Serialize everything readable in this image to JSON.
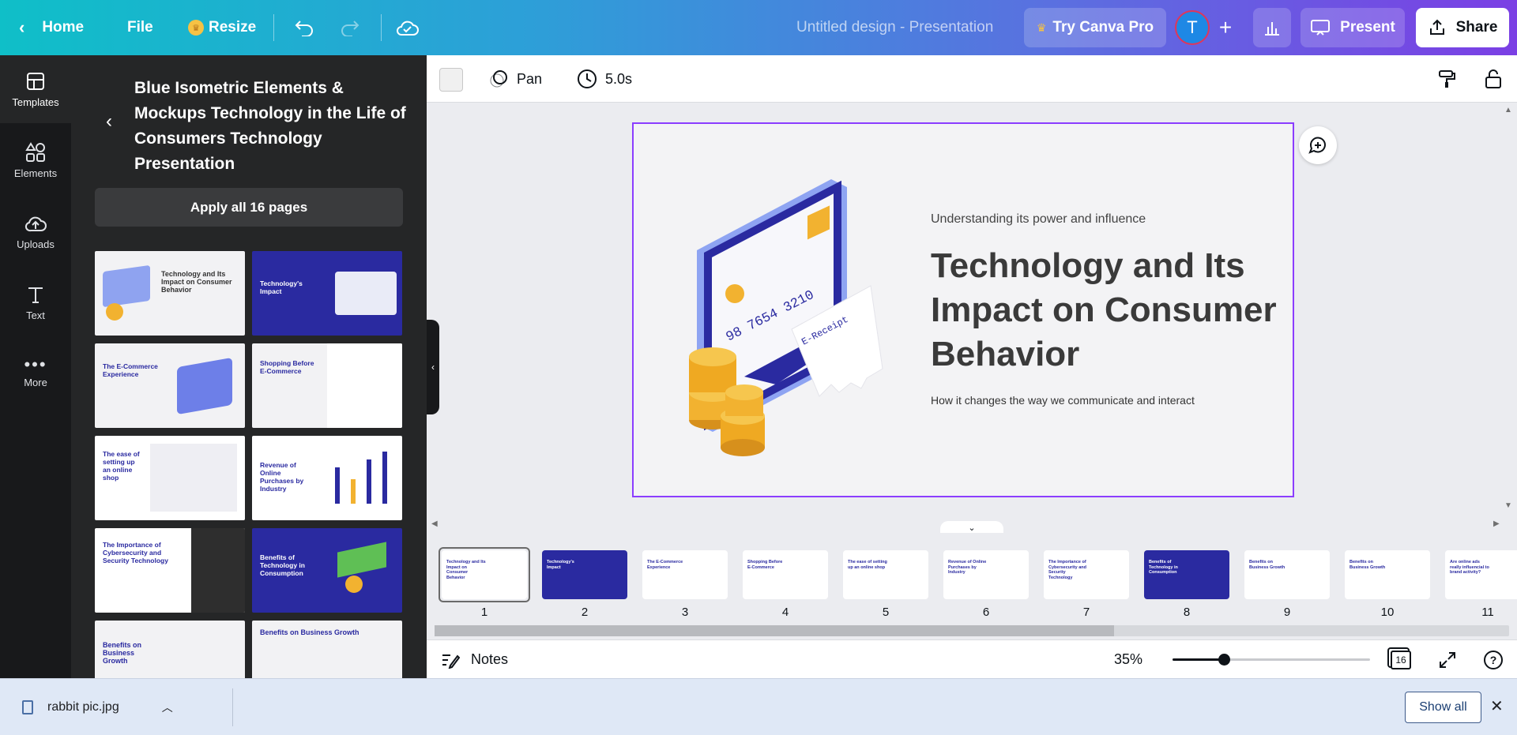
{
  "topbar": {
    "home": "Home",
    "file": "File",
    "resize": "Resize",
    "doc_title": "Untitled design - Presentation",
    "try_pro": "Try Canva Pro",
    "avatar_letter": "T",
    "present": "Present",
    "share": "Share"
  },
  "rail": {
    "items": [
      {
        "label": "Templates",
        "icon": "templates-icon"
      },
      {
        "label": "Elements",
        "icon": "elements-icon"
      },
      {
        "label": "Uploads",
        "icon": "uploads-icon"
      },
      {
        "label": "Text",
        "icon": "text-icon"
      },
      {
        "label": "More",
        "icon": "more-icon"
      }
    ]
  },
  "panel": {
    "title": "Blue Isometric Elements & Mockups Technology in the Life of Consumers Technology Presentation",
    "apply_label": "Apply all 16 pages",
    "templates": [
      "Technology and Its Impact on Consumer Behavior",
      "Technology's Impact",
      "The E-Commerce Experience",
      "Shopping Before E-Commerce",
      "The ease of setting up an online shop",
      "Revenue of Online Purchases by Industry",
      "The Importance of Cybersecurity and Security Technology",
      "Benefits of Technology in Consumption",
      "Benefits on Business Growth",
      "Benefits on Business Growth"
    ]
  },
  "editor_toolbar": {
    "pan": "Pan",
    "duration": "5.0s"
  },
  "slide": {
    "subtitle": "Understanding its power and influence",
    "title": "Technology and Its Impact on Consumer Behavior",
    "footer": "How it changes the way we communicate and interact",
    "card_number": "98 7654 3210",
    "receipt_text": "E-Receipt"
  },
  "pages": [
    {
      "num": "1",
      "label": "Technology and Its Impact on Consumer Behavior",
      "theme": "light"
    },
    {
      "num": "2",
      "label": "Technology's Impact",
      "theme": "dark"
    },
    {
      "num": "3",
      "label": "The E-Commerce Experience",
      "theme": "light"
    },
    {
      "num": "4",
      "label": "Shopping Before E-Commerce",
      "theme": "light"
    },
    {
      "num": "5",
      "label": "The ease of setting up an online shop",
      "theme": "light"
    },
    {
      "num": "6",
      "label": "Revenue of Online Purchases by Industry",
      "theme": "light"
    },
    {
      "num": "7",
      "label": "The Importance of Cybersecurity and Security Technology",
      "theme": "light"
    },
    {
      "num": "8",
      "label": "Benefits of Technology in Consumption",
      "theme": "dark"
    },
    {
      "num": "9",
      "label": "Benefits on Business Growth",
      "theme": "light"
    },
    {
      "num": "10",
      "label": "Benefits on Business Growth",
      "theme": "light"
    },
    {
      "num": "11",
      "label": "Are online ads really influencial to brand activity?",
      "theme": "light"
    }
  ],
  "bottombar": {
    "notes": "Notes",
    "zoom": "35%",
    "zoom_fraction": 0.26,
    "page_count": "16"
  },
  "downloads": {
    "file_name": "rabbit pic.jpg",
    "show_all": "Show all"
  },
  "colors": {
    "accent": "#8b3dff",
    "slide_navy": "#2a2aa0",
    "coin": "#f2b230"
  }
}
